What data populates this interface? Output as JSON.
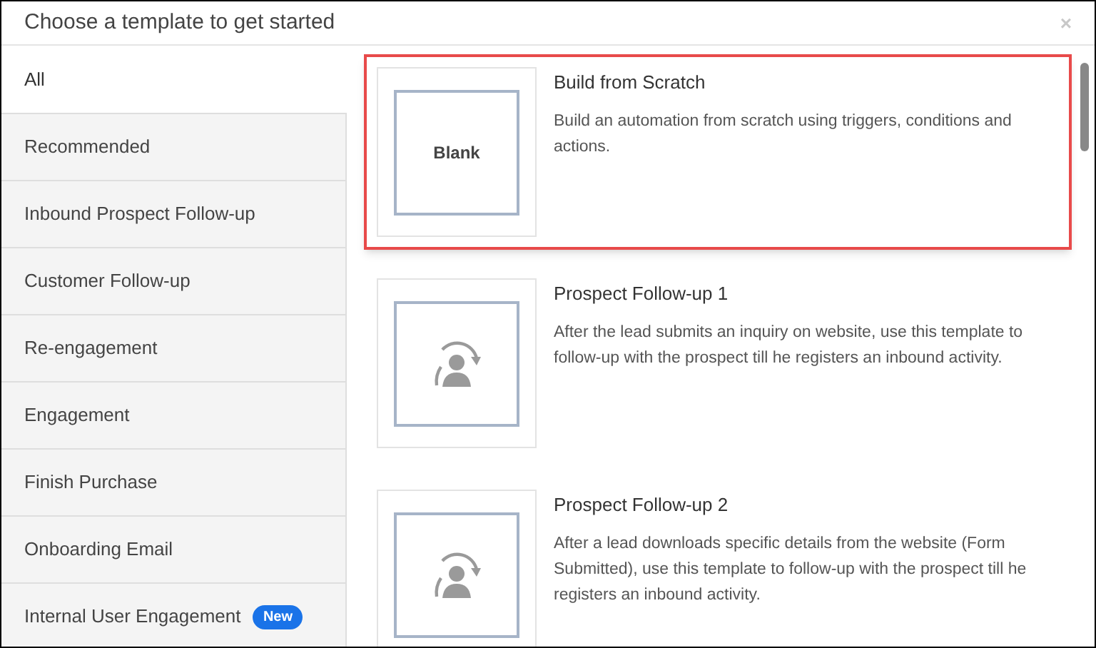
{
  "window": {
    "title": "Choose a template to get started",
    "close": "×"
  },
  "sidebar": {
    "items": [
      {
        "label": "All",
        "selected": true
      },
      {
        "label": "Recommended",
        "selected": false
      },
      {
        "label": "Inbound Prospect Follow-up",
        "selected": false
      },
      {
        "label": "Customer Follow-up",
        "selected": false
      },
      {
        "label": "Re-engagement",
        "selected": false
      },
      {
        "label": "Engagement",
        "selected": false
      },
      {
        "label": "Finish Purchase",
        "selected": false
      },
      {
        "label": "Onboarding Email",
        "selected": false
      },
      {
        "label": "Internal User Engagement",
        "selected": false,
        "badge": "New"
      }
    ]
  },
  "templates": [
    {
      "kind": "blank",
      "thumbnail_label": "Blank",
      "title": "Build from Scratch",
      "description": "Build an automation from scratch using triggers, conditions and actions.",
      "selected": true
    },
    {
      "kind": "template",
      "title": "Prospect Follow-up 1",
      "description": "After the lead submits an inquiry on website, use this template to follow-up with the prospect till he registers an inbound activity.",
      "selected": false
    },
    {
      "kind": "template",
      "title": "Prospect Follow-up 2",
      "description": "After a lead downloads specific details from the website (Form Submitted), use this template to follow-up with the prospect till he registers an inbound activity.",
      "selected": false
    }
  ]
}
